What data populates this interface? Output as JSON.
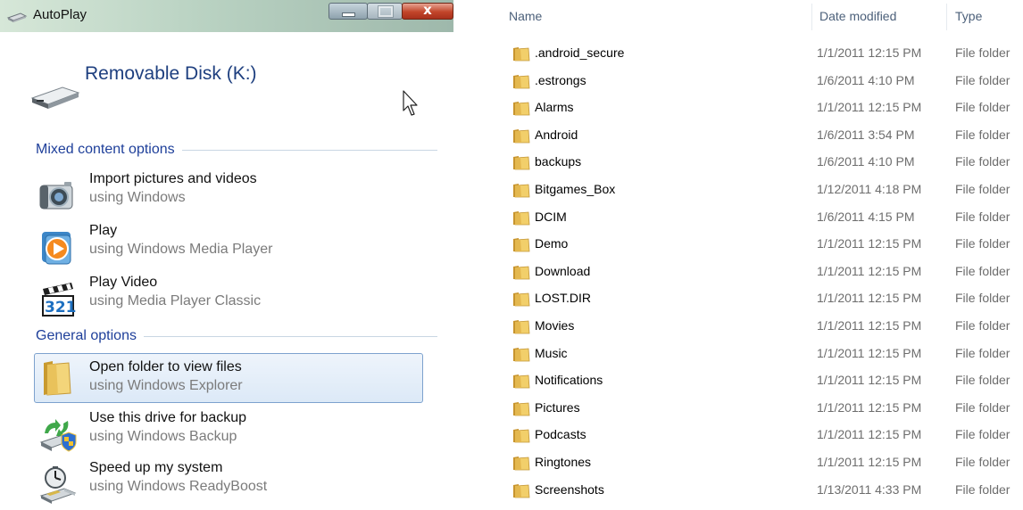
{
  "autoplay": {
    "title": "AutoPlay",
    "device": "Removable Disk (K:)",
    "sections": [
      {
        "heading": "Mixed content options",
        "options": [
          {
            "icon": "camera-icon",
            "title": "Import pictures and videos",
            "subtitle": "using Windows"
          },
          {
            "icon": "media-player-icon",
            "title": "Play",
            "subtitle": "using Windows Media Player"
          },
          {
            "icon": "clapperboard-icon",
            "title": "Play Video",
            "subtitle": "using Media Player Classic"
          }
        ]
      },
      {
        "heading": "General options",
        "options": [
          {
            "icon": "folder-icon",
            "title": "Open folder to view files",
            "subtitle": "using Windows Explorer",
            "selected": true
          },
          {
            "icon": "backup-icon",
            "title": "Use this drive for backup",
            "subtitle": "using Windows Backup"
          },
          {
            "icon": "readyboost-icon",
            "title": "Speed up my system",
            "subtitle": "using Windows ReadyBoost"
          }
        ]
      }
    ],
    "window_buttons": {
      "close_label": "x"
    }
  },
  "explorer": {
    "columns": {
      "name": "Name",
      "date": "Date modified",
      "type": "Type"
    },
    "files": [
      {
        "name": ".android_secure",
        "date": "1/1/2011 12:15 PM",
        "type": "File folder"
      },
      {
        "name": ".estrongs",
        "date": "1/6/2011 4:10 PM",
        "type": "File folder"
      },
      {
        "name": "Alarms",
        "date": "1/1/2011 12:15 PM",
        "type": "File folder"
      },
      {
        "name": "Android",
        "date": "1/6/2011 3:54 PM",
        "type": "File folder"
      },
      {
        "name": "backups",
        "date": "1/6/2011 4:10 PM",
        "type": "File folder"
      },
      {
        "name": "Bitgames_Box",
        "date": "1/12/2011 4:18 PM",
        "type": "File folder"
      },
      {
        "name": "DCIM",
        "date": "1/6/2011 4:15 PM",
        "type": "File folder"
      },
      {
        "name": "Demo",
        "date": "1/1/2011 12:15 PM",
        "type": "File folder"
      },
      {
        "name": "Download",
        "date": "1/1/2011 12:15 PM",
        "type": "File folder"
      },
      {
        "name": "LOST.DIR",
        "date": "1/1/2011 12:15 PM",
        "type": "File folder"
      },
      {
        "name": "Movies",
        "date": "1/1/2011 12:15 PM",
        "type": "File folder"
      },
      {
        "name": "Music",
        "date": "1/1/2011 12:15 PM",
        "type": "File folder"
      },
      {
        "name": "Notifications",
        "date": "1/1/2011 12:15 PM",
        "type": "File folder"
      },
      {
        "name": "Pictures",
        "date": "1/1/2011 12:15 PM",
        "type": "File folder"
      },
      {
        "name": "Podcasts",
        "date": "1/1/2011 12:15 PM",
        "type": "File folder"
      },
      {
        "name": "Ringtones",
        "date": "1/1/2011 12:15 PM",
        "type": "File folder"
      },
      {
        "name": "Screenshots",
        "date": "1/13/2011 4:33 PM",
        "type": "File folder"
      }
    ]
  }
}
